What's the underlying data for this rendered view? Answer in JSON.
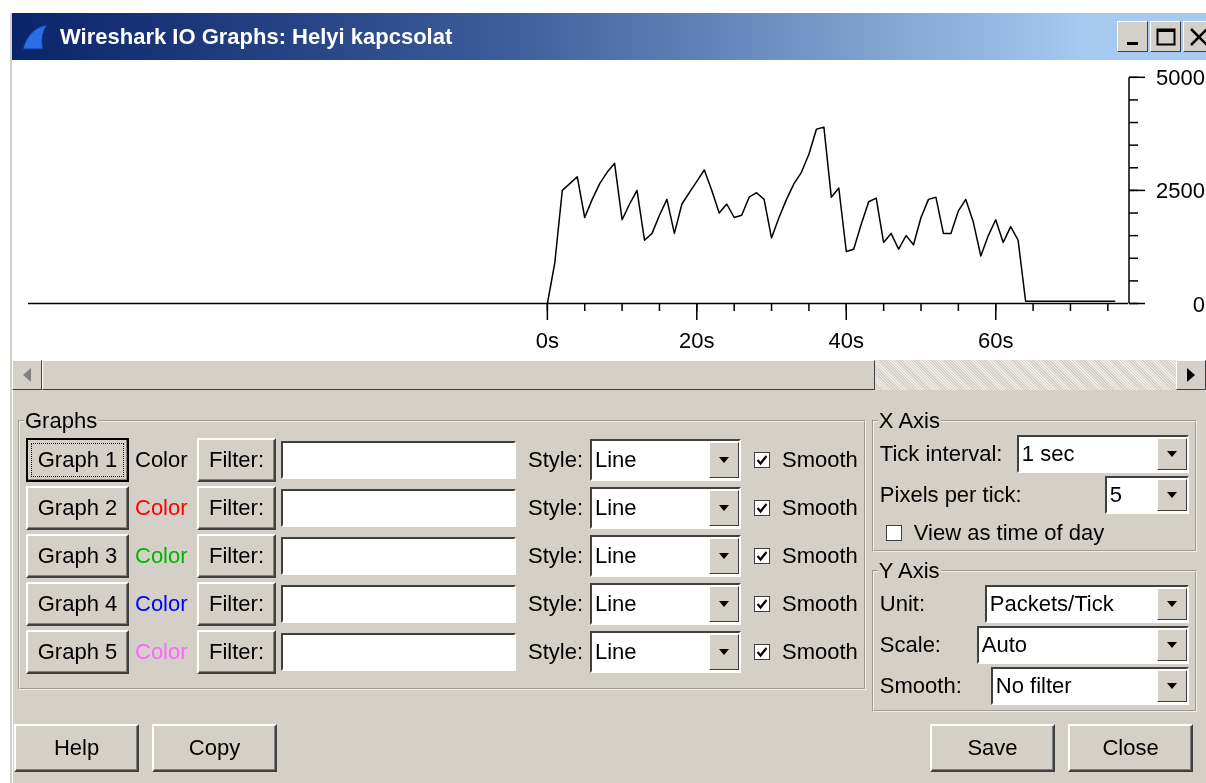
{
  "window": {
    "title": "Wireshark IO Graphs: Helyi kapcsolat"
  },
  "chart": {
    "chart_data": {
      "type": "line",
      "xlim": [
        -69.5,
        77.7
      ],
      "ylim": [
        0,
        5000
      ],
      "xticks": [
        {
          "value": 0,
          "label": "0s"
        },
        {
          "value": 20,
          "label": "20s"
        },
        {
          "value": 40,
          "label": "40s"
        },
        {
          "value": 60,
          "label": "60s"
        }
      ],
      "yticks": [
        0,
        2500,
        5000
      ],
      "x": [
        0,
        1,
        2,
        3,
        4,
        5,
        6,
        7,
        8,
        9,
        10,
        11,
        12,
        13,
        14,
        15,
        16,
        17,
        18,
        19,
        20,
        21,
        22,
        23,
        24,
        25,
        26,
        27,
        28,
        29,
        30,
        31,
        32,
        33,
        34,
        35,
        36,
        37,
        38,
        39,
        40,
        41,
        42,
        43,
        44,
        45,
        46,
        47,
        48,
        49,
        50,
        51,
        52,
        53,
        54,
        55,
        56,
        57,
        58,
        59,
        60,
        61,
        62,
        63,
        64,
        65,
        66,
        67,
        68,
        69,
        70,
        71,
        72,
        73,
        74,
        75,
        76
      ],
      "series": [
        {
          "color": "#000000",
          "values": [
            0,
            900,
            2500,
            2650,
            2800,
            1900,
            2300,
            2650,
            2900,
            3100,
            1850,
            2200,
            2500,
            1400,
            1550,
            1950,
            2300,
            1550,
            2200,
            2450,
            2700,
            2950,
            2500,
            2000,
            2200,
            1900,
            1950,
            2350,
            2450,
            2300,
            1450,
            1900,
            2300,
            2650,
            2900,
            3300,
            3850,
            3900,
            2350,
            2550,
            1150,
            1200,
            1750,
            2250,
            2330,
            1350,
            1550,
            1200,
            1500,
            1300,
            1900,
            2300,
            2350,
            1550,
            1550,
            2050,
            2300,
            1800,
            1050,
            1500,
            1850,
            1350,
            1700,
            1400,
            50,
            50,
            50,
            50,
            50,
            50,
            50,
            50,
            50,
            50,
            50,
            50,
            50
          ]
        }
      ]
    }
  },
  "graphs_panel": {
    "title": "Graphs",
    "rows": [
      {
        "button": "Graph 1",
        "focused": true,
        "color_label": "Color",
        "color": "#000000",
        "filter_button": "Filter:",
        "style_label": "Style:",
        "style": "Line",
        "smooth_label": "Smooth",
        "smooth": true
      },
      {
        "button": "Graph 2",
        "focused": false,
        "color_label": "Color",
        "color": "#ff0000",
        "filter_button": "Filter:",
        "style_label": "Style:",
        "style": "Line",
        "smooth_label": "Smooth",
        "smooth": true
      },
      {
        "button": "Graph 3",
        "focused": false,
        "color_label": "Color",
        "color": "#00b400",
        "filter_button": "Filter:",
        "style_label": "Style:",
        "style": "Line",
        "smooth_label": "Smooth",
        "smooth": true
      },
      {
        "button": "Graph 4",
        "focused": false,
        "color_label": "Color",
        "color": "#0000ff",
        "filter_button": "Filter:",
        "style_label": "Style:",
        "style": "Line",
        "smooth_label": "Smooth",
        "smooth": true
      },
      {
        "button": "Graph 5",
        "focused": false,
        "color_label": "Color",
        "color": "#ff66ff",
        "filter_button": "Filter:",
        "style_label": "Style:",
        "style": "Line",
        "smooth_label": "Smooth",
        "smooth": true
      }
    ]
  },
  "x_axis": {
    "title": "X Axis",
    "tick_interval": {
      "label": "Tick interval:",
      "value": "1 sec"
    },
    "pixels_per_tick": {
      "label": "Pixels per tick:",
      "value": "5"
    },
    "time_of_day": {
      "label": "View as time of day",
      "checked": false
    }
  },
  "y_axis": {
    "title": "Y Axis",
    "unit": {
      "label": "Unit:",
      "value": "Packets/Tick"
    },
    "scale": {
      "label": "Scale:",
      "value": "Auto"
    },
    "smooth": {
      "label": "Smooth:",
      "value": "No filter"
    }
  },
  "left_buttons": [
    {
      "label": "Help"
    },
    {
      "label": "Copy"
    }
  ],
  "right_buttons": [
    {
      "label": "Save"
    },
    {
      "label": "Close"
    }
  ]
}
